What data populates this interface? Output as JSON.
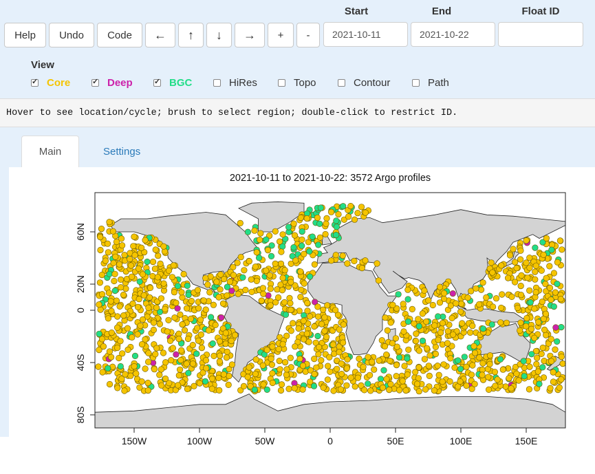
{
  "toolbar": {
    "help": "Help",
    "undo": "Undo",
    "code": "Code",
    "left_arrow": "←",
    "up_arrow": "↑",
    "down_arrow": "↓",
    "right_arrow": "→",
    "zoom_in": "+",
    "zoom_out": "-"
  },
  "filters": {
    "start_label": "Start",
    "start_value": "2021-10-11",
    "end_label": "End",
    "end_value": "2021-10-22",
    "float_id_label": "Float ID",
    "float_id_value": ""
  },
  "view": {
    "label": "View",
    "options": [
      {
        "label": "Core",
        "checked": true,
        "color": "#f5c400"
      },
      {
        "label": "Deep",
        "checked": true,
        "color": "#cc22aa"
      },
      {
        "label": "BGC",
        "checked": true,
        "color": "#22dd88"
      },
      {
        "label": "HiRes",
        "checked": false
      },
      {
        "label": "Topo",
        "checked": false
      },
      {
        "label": "Contour",
        "checked": false
      },
      {
        "label": "Path",
        "checked": false
      }
    ]
  },
  "status": "Hover to see location/cycle; brush to select region; double-click to restrict ID.",
  "tabs": [
    {
      "label": "Main",
      "active": true
    },
    {
      "label": "Settings",
      "active": false
    }
  ],
  "chart_data": {
    "type": "scatter",
    "title": "2021-10-11 to 2021-10-22: 3572 Argo profiles",
    "x_ticks": [
      "150W",
      "100W",
      "50W",
      "0",
      "50E",
      "100E",
      "150E"
    ],
    "x_tick_values": [
      -150,
      -100,
      -50,
      0,
      50,
      100,
      150
    ],
    "y_ticks": [
      "60N",
      "20N",
      "0",
      "40S",
      "80S"
    ],
    "y_tick_values": [
      60,
      20,
      0,
      -40,
      -80
    ],
    "xlim": [
      -180,
      180
    ],
    "ylim": [
      -90,
      90
    ],
    "colors": {
      "core": "#f5c400",
      "deep": "#cc22aa",
      "bgc": "#22dd88",
      "land": "#d3d3d3"
    },
    "series": [
      {
        "name": "Core",
        "color": "#f5c400"
      },
      {
        "name": "Deep",
        "color": "#cc22aa"
      },
      {
        "name": "BGC",
        "color": "#22dd88"
      }
    ]
  }
}
